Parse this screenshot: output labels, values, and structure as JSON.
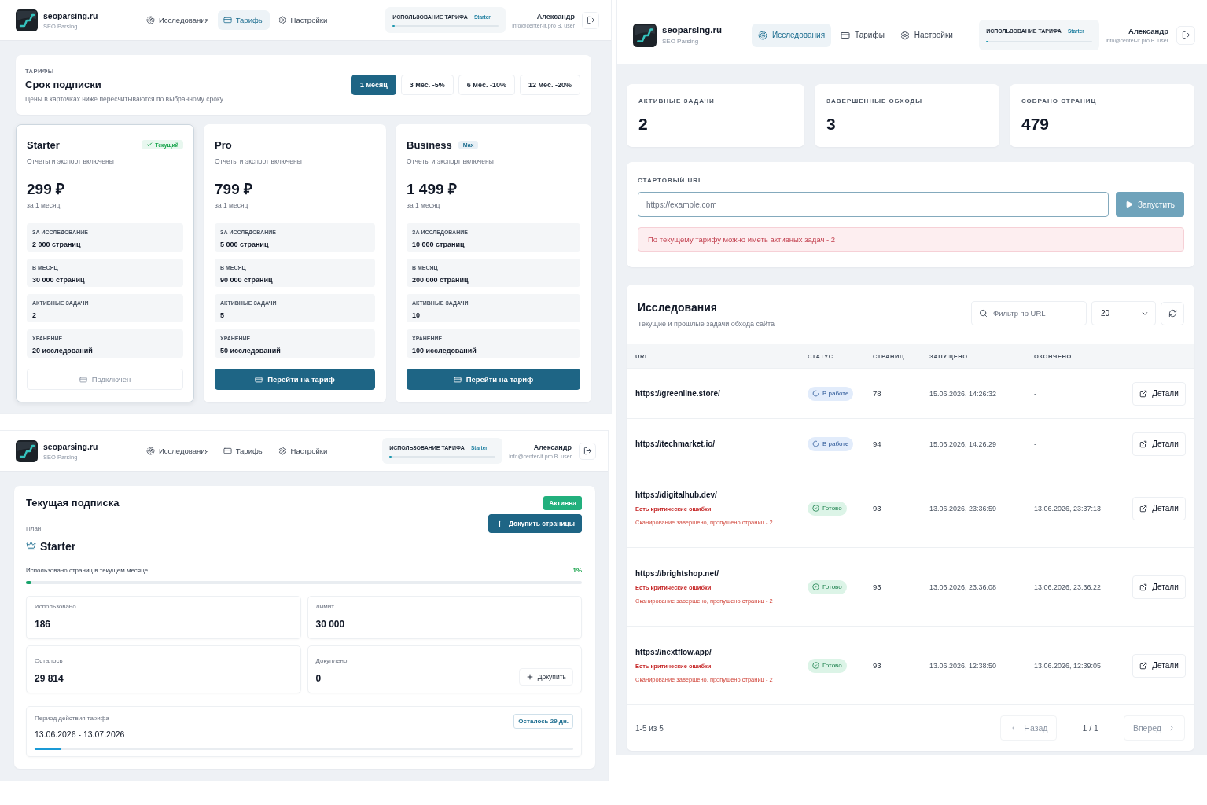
{
  "tariffs_screen": {
    "header": {
      "brand": {
        "name": "seoparsing.ru",
        "tagline": "SEO Parsing"
      },
      "nav": [
        {
          "label": "Исследования",
          "selected": false
        },
        {
          "label": "Тарифы",
          "selected": true
        },
        {
          "label": "Настройки",
          "selected": false
        }
      ],
      "usage": {
        "label": "ИСПОЛЬЗОВАНИЕ ТАРИФА",
        "plan": "Starter",
        "level": 0.01
      },
      "user": {
        "name": "Александр",
        "email": "info@center-it.pro B. user"
      }
    },
    "period_picker": {
      "eyebrow": "ТАРИФЫ",
      "title": "Срок подписки",
      "subtitle": "Цены в карточках ниже пересчитываются по выбранному сроку.",
      "options": [
        {
          "label": "1 месяц",
          "selected": true
        },
        {
          "label": "3 мес. -5%",
          "selected": false
        },
        {
          "label": "6 мес. -10%",
          "selected": false
        },
        {
          "label": "12 мес. -20%",
          "selected": false
        }
      ]
    },
    "plans": [
      {
        "name": "Starter",
        "selected": true,
        "badge": {
          "label": "Текущий",
          "kind": "current"
        },
        "subtitle": "Отчеты и экспорт включены",
        "price": "299 ₽",
        "period": "за 1 месяц",
        "features": [
          {
            "label": "ЗА ИССЛЕДОВАНИЕ",
            "value": "2 000 страниц"
          },
          {
            "label": "В МЕСЯЦ",
            "value": "30 000 страниц"
          },
          {
            "label": "АКТИВНЫЕ ЗАДАЧИ",
            "value": "2"
          },
          {
            "label": "ХРАНЕНИЕ",
            "value": "20 исследований"
          }
        ],
        "button": {
          "label": "Подключен",
          "disabled": true
        }
      },
      {
        "name": "Pro",
        "selected": false,
        "subtitle": "Отчеты и экспорт включены",
        "price": "799 ₽",
        "period": "за 1 месяц",
        "features": [
          {
            "label": "ЗА ИССЛЕДОВАНИЕ",
            "value": "5 000 страниц"
          },
          {
            "label": "В МЕСЯЦ",
            "value": "90 000 страниц"
          },
          {
            "label": "АКТИВНЫЕ ЗАДАЧИ",
            "value": "5"
          },
          {
            "label": "ХРАНЕНИЕ",
            "value": "50 исследований"
          }
        ],
        "button": {
          "label": "Перейти на тариф",
          "disabled": false
        }
      },
      {
        "name": "Business",
        "selected": false,
        "badge": {
          "label": "Max",
          "kind": "max"
        },
        "subtitle": "Отчеты и экспорт включены",
        "price": "1 499 ₽",
        "period": "за 1 месяц",
        "features": [
          {
            "label": "ЗА ИССЛЕДОВАНИЕ",
            "value": "10 000 страниц"
          },
          {
            "label": "В МЕСЯЦ",
            "value": "200 000 страниц"
          },
          {
            "label": "АКТИВНЫЕ ЗАДАЧИ",
            "value": "10"
          },
          {
            "label": "ХРАНЕНИЕ",
            "value": "100 исследований"
          }
        ],
        "button": {
          "label": "Перейти на тариф",
          "disabled": false
        }
      }
    ]
  },
  "subscription_screen": {
    "header": {
      "brand": {
        "name": "seoparsing.ru",
        "tagline": "SEO Parsing"
      },
      "nav": [
        {
          "label": "Исследования",
          "selected": false
        },
        {
          "label": "Тарифы",
          "selected": false
        },
        {
          "label": "Настройки",
          "selected": false
        }
      ],
      "usage": {
        "label": "ИСПОЛЬЗОВАНИЕ ТАРИФА",
        "plan": "Starter",
        "level": 0.01
      },
      "user": {
        "name": "Александр",
        "email": "info@center-it.pro B. user"
      }
    },
    "subscription": {
      "title": "Текущая подписка",
      "status": {
        "label": "Активна",
        "kind": "active"
      },
      "buy_button": "Докупить страницы",
      "plan_label": "План",
      "plan_name": "Starter",
      "usage": {
        "label": "Использовано страниц в текущем месяце",
        "percent": "1%",
        "level": 0.01
      },
      "stats": [
        {
          "label": "Использовано",
          "value": "186"
        },
        {
          "label": "Лимит",
          "value": "30 000"
        },
        {
          "label": "Осталось",
          "value": "29 814"
        },
        {
          "label": "Докуплено",
          "value": "0",
          "action": "Докупить"
        }
      ],
      "term": {
        "label": "Период действия тарифа",
        "dates": "13.06.2026 - 13.07.2026",
        "remaining": "Осталось 29 дн.",
        "level": 0.05
      }
    }
  },
  "research_screen": {
    "header": {
      "brand": {
        "name": "seoparsing.ru",
        "tagline": "SEO Parsing"
      },
      "nav": [
        {
          "label": "Исследования",
          "selected": true
        },
        {
          "label": "Тарифы",
          "selected": false
        },
        {
          "label": "Настройки",
          "selected": false
        }
      ],
      "usage": {
        "label": "ИСПОЛЬЗОВАНИЕ ТАРИФА",
        "plan": "Starter",
        "level": 0.01
      },
      "user": {
        "name": "Александр",
        "email": "info@center-it.pro B. user"
      }
    },
    "stats": [
      {
        "label": "АКТИВНЫЕ ЗАДАЧИ",
        "value": "2"
      },
      {
        "label": "ЗАВЕРШЕННЫЕ ОБХОДЫ",
        "value": "3"
      },
      {
        "label": "СОБРАНО СТРАНИЦ",
        "value": "479"
      }
    ],
    "start_form": {
      "label": "СТАРТОВЫЙ URL",
      "placeholder": "https://example.com",
      "button": {
        "label": "Запустить",
        "disabled": true
      },
      "alert": "По текущему тарифу можно иметь активных задач - 2"
    },
    "studies": {
      "title": "Исследования",
      "subtitle": "Текущие и прошлые задачи обхода сайта",
      "filter": {
        "placeholder": "Фильтр по URL"
      },
      "page_size": "20",
      "columns": [
        "URL",
        "СТАТУС",
        "СТРАНИЦ",
        "ЗАПУЩЕНО",
        "ОКОНЧЕНО"
      ],
      "rows": [
        {
          "url": "https://greenline.store/",
          "status": {
            "label": "В работе",
            "kind": "running"
          },
          "pages": "78",
          "started": "15.06.2026, 14:26:32",
          "finished": "-",
          "action": "Детали"
        },
        {
          "url": "https://techmarket.io/",
          "status": {
            "label": "В работе",
            "kind": "running"
          },
          "pages": "94",
          "started": "15.06.2026, 14:26:29",
          "finished": "-",
          "action": "Детали"
        },
        {
          "url": "https://digitalhub.dev/",
          "notes": [
            {
              "text": "Есть критические ошибки",
              "kind": "critical"
            },
            {
              "text": "Сканирование завершено, пропущено страниц - 2",
              "kind": "warning"
            }
          ],
          "status": {
            "label": "Готово",
            "kind": "done"
          },
          "pages": "93",
          "started": "13.06.2026, 23:36:59",
          "finished": "13.06.2026, 23:37:13",
          "action": "Детали"
        },
        {
          "url": "https://brightshop.net/",
          "notes": [
            {
              "text": "Есть критические ошибки",
              "kind": "critical"
            },
            {
              "text": "Сканирование завершено, пропущено страниц - 2",
              "kind": "warning"
            }
          ],
          "status": {
            "label": "Готово",
            "kind": "done"
          },
          "pages": "93",
          "started": "13.06.2026, 23:36:08",
          "finished": "13.06.2026, 23:36:22",
          "action": "Детали"
        },
        {
          "url": "https://nextflow.app/",
          "notes": [
            {
              "text": "Есть критические ошибки",
              "kind": "critical"
            },
            {
              "text": "Сканирование завершено, пропущено страниц - 2",
              "kind": "warning"
            }
          ],
          "status": {
            "label": "Готово",
            "kind": "done"
          },
          "pages": "93",
          "started": "13.06.2026, 12:38:50",
          "finished": "13.06.2026, 12:39:05",
          "action": "Детали"
        }
      ],
      "pagination": {
        "summary": "1-5 из 5",
        "prev": {
          "label": "Назад",
          "disabled": true
        },
        "page": "1 / 1",
        "next": {
          "label": "Вперед",
          "disabled": true
        }
      }
    }
  }
}
